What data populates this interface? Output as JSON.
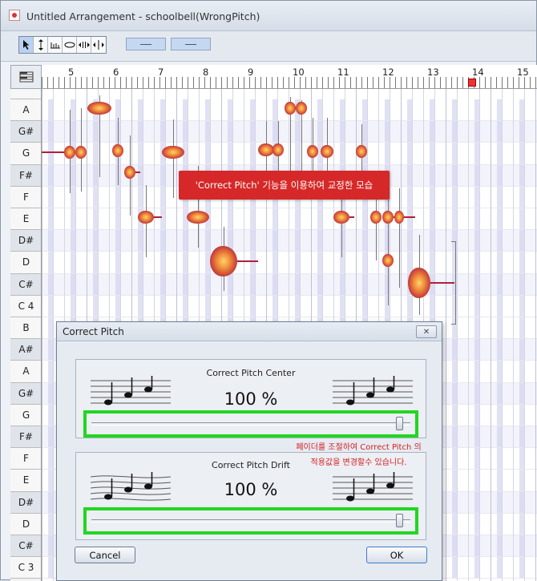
{
  "window": {
    "title": "Untitled Arrangement - schoolbell(WrongPitch)"
  },
  "toolbar": {
    "tools": [
      "pointer-tool",
      "pitch-tool",
      "tempo-tool",
      "note-tool",
      "time-stretch-tool",
      "split-tool"
    ]
  },
  "ruler": {
    "bars": [
      "5",
      "6",
      "7",
      "8",
      "9",
      "10",
      "11",
      "12",
      "13",
      "14",
      "15"
    ]
  },
  "keyboard": {
    "keys": [
      "A",
      "G#",
      "G",
      "F#",
      "F",
      "E",
      "D#",
      "D",
      "C#",
      "C 4",
      "B",
      "A#",
      "A",
      "G#",
      "G",
      "F#",
      "F",
      "E",
      "D#",
      "D",
      "C#",
      "C 3"
    ]
  },
  "callout": {
    "text": "'Correct Pitch' 기능을 이용하여 교정한 모습"
  },
  "dialog": {
    "title": "Correct Pitch",
    "close_label": "✕",
    "center": {
      "label": "Correct Pitch Center",
      "value": "100 %",
      "slider": 1.0
    },
    "drift": {
      "label": "Correct Pitch Drift",
      "value": "100 %",
      "slider": 1.0
    },
    "note_line1": "페이더를 조절하여 Correct Pitch 의",
    "note_line2": "적용값을 변경할수 있습니다.",
    "cancel_label": "Cancel",
    "ok_label": "OK"
  },
  "colors": {
    "highlight": "#22d622",
    "callout": "#d62828",
    "note": "#c23a3a"
  }
}
